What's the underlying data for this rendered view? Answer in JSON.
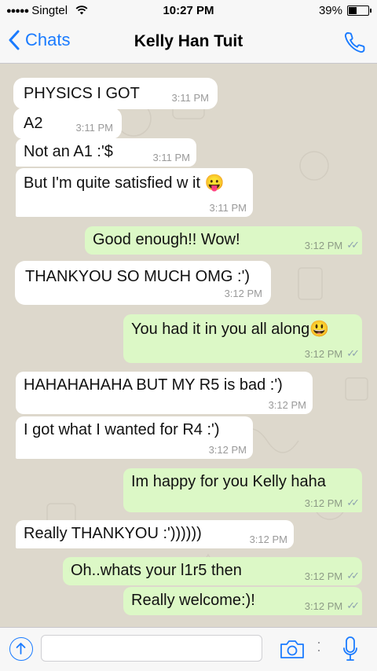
{
  "status_bar": {
    "carrier": "Singtel",
    "time": "10:27 PM",
    "battery_percent": "39%",
    "battery_level": 0.39
  },
  "nav": {
    "back_label": "Chats",
    "title": "Kelly Han Tuit",
    "back_icon": "chevron-left-icon",
    "call_icon": "phone-icon"
  },
  "messages": [
    {
      "direction": "in",
      "text": "PHYSICS I GOT",
      "time": "3:11 PM"
    },
    {
      "direction": "in",
      "text": "A2",
      "time": "3:11 PM"
    },
    {
      "direction": "in",
      "text": "Not an A1 :'$",
      "time": "3:11 PM"
    },
    {
      "direction": "in",
      "text": "But I'm quite satisfied w it 😛",
      "time": "3:11 PM"
    },
    {
      "direction": "out",
      "text": "Good enough!! Wow!",
      "time": "3:12 PM"
    },
    {
      "direction": "in",
      "text": "THANKYOU SO MUCH OMG :')",
      "time": "3:12 PM"
    },
    {
      "direction": "out",
      "text": "You had it in you all along😃",
      "time": "3:12 PM"
    },
    {
      "direction": "in",
      "text": "HAHAHAHAHA BUT MY R5 is bad :')",
      "time": "3:12 PM"
    },
    {
      "direction": "in",
      "text": "I got what I wanted for R4 :')",
      "time": "3:12 PM"
    },
    {
      "direction": "out",
      "text": "Im happy for you Kelly haha",
      "time": "3:12 PM"
    },
    {
      "direction": "in",
      "text": "Really THANKYOU :'))))))",
      "time": "3:12 PM"
    },
    {
      "direction": "out",
      "text": "Oh..whats your l1r5 then",
      "time": "3:12 PM"
    },
    {
      "direction": "out",
      "text": "Really welcome:)!",
      "time": "3:12 PM"
    }
  ],
  "colors": {
    "accent": "#1a7bff",
    "incoming_bubble": "#ffffff",
    "outgoing_bubble": "#dcf8c6",
    "chat_background": "#ddd8cc"
  },
  "input_bar": {
    "share_icon": "share-arrow-icon",
    "camera_icon": "camera-icon",
    "mic_icon": "microphone-icon"
  }
}
